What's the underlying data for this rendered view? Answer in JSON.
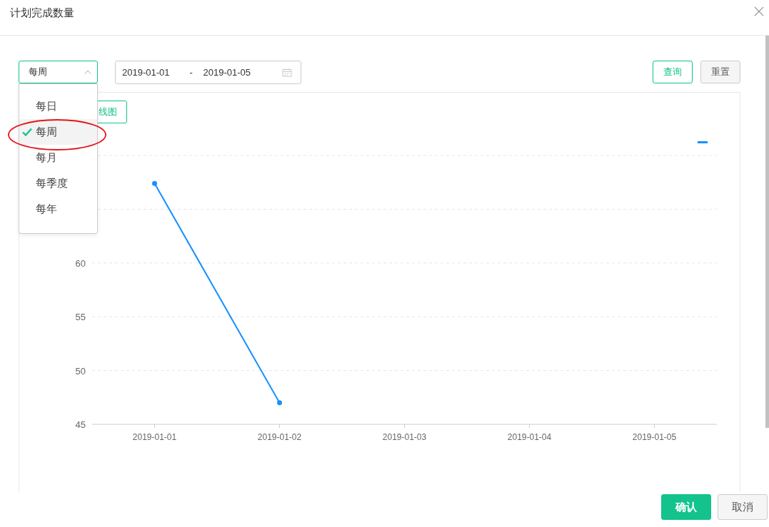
{
  "dialog": {
    "title": "计划完成数量"
  },
  "toolbar": {
    "period_select": {
      "value": "每周",
      "expanded": true,
      "options": [
        {
          "label": "每日",
          "selected": false
        },
        {
          "label": "每周",
          "selected": true
        },
        {
          "label": "每月",
          "selected": false
        },
        {
          "label": "每季度",
          "selected": false
        },
        {
          "label": "每年",
          "selected": false
        }
      ]
    },
    "date_range": {
      "start": "2019-01-01",
      "separator": "-",
      "end": "2019-01-05"
    },
    "buttons": [
      {
        "label": "查询",
        "kind": "outline"
      },
      {
        "label": "重置",
        "kind": "default"
      }
    ]
  },
  "chart_card": {
    "chart_type_button": "线图",
    "chart_data": {
      "type": "line",
      "categories": [
        "2019-01-01",
        "2019-01-02",
        "2019-01-03",
        "2019-01-04",
        "2019-01-05"
      ],
      "series": [
        {
          "color": "#1890ff",
          "marker": "circle",
          "values": [
            67.4,
            47,
            null,
            null,
            null
          ]
        }
      ],
      "grid": true,
      "ylim": [
        45,
        70
      ],
      "yticks": [
        45,
        50,
        55,
        60
      ]
    }
  },
  "footer": {
    "buttons": [
      {
        "label": "确认",
        "kind": "primary"
      },
      {
        "label": "取消",
        "kind": "default"
      }
    ]
  }
}
